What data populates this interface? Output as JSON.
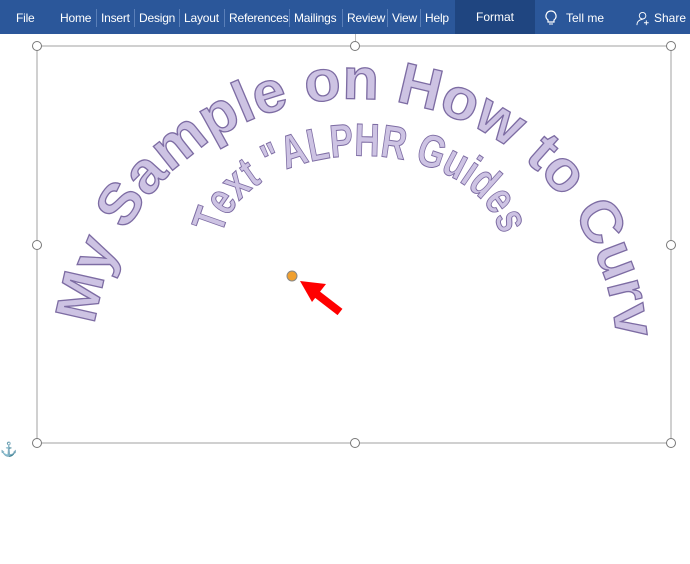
{
  "ribbon": {
    "tabs": [
      "File",
      "Home",
      "Insert",
      "Design",
      "Layout",
      "References",
      "Mailings",
      "Review",
      "View",
      "Help"
    ],
    "format_tab": "Format",
    "tell_me": "Tell me",
    "share": "Share",
    "background": "#2b579a",
    "icons": {
      "tell_me": "lightbulb-icon",
      "share": "person-add-icon"
    }
  },
  "document": {
    "outer_text": "My Sample on How to Curve",
    "inner_text": "Text \"ALPHR Guides\"",
    "wordart_fill": "#cdc3e3",
    "wordart_stroke": "#7d6ca3",
    "annotation_arrow_color": "#ff0000",
    "adjust_handle_color": "#f0a030"
  }
}
